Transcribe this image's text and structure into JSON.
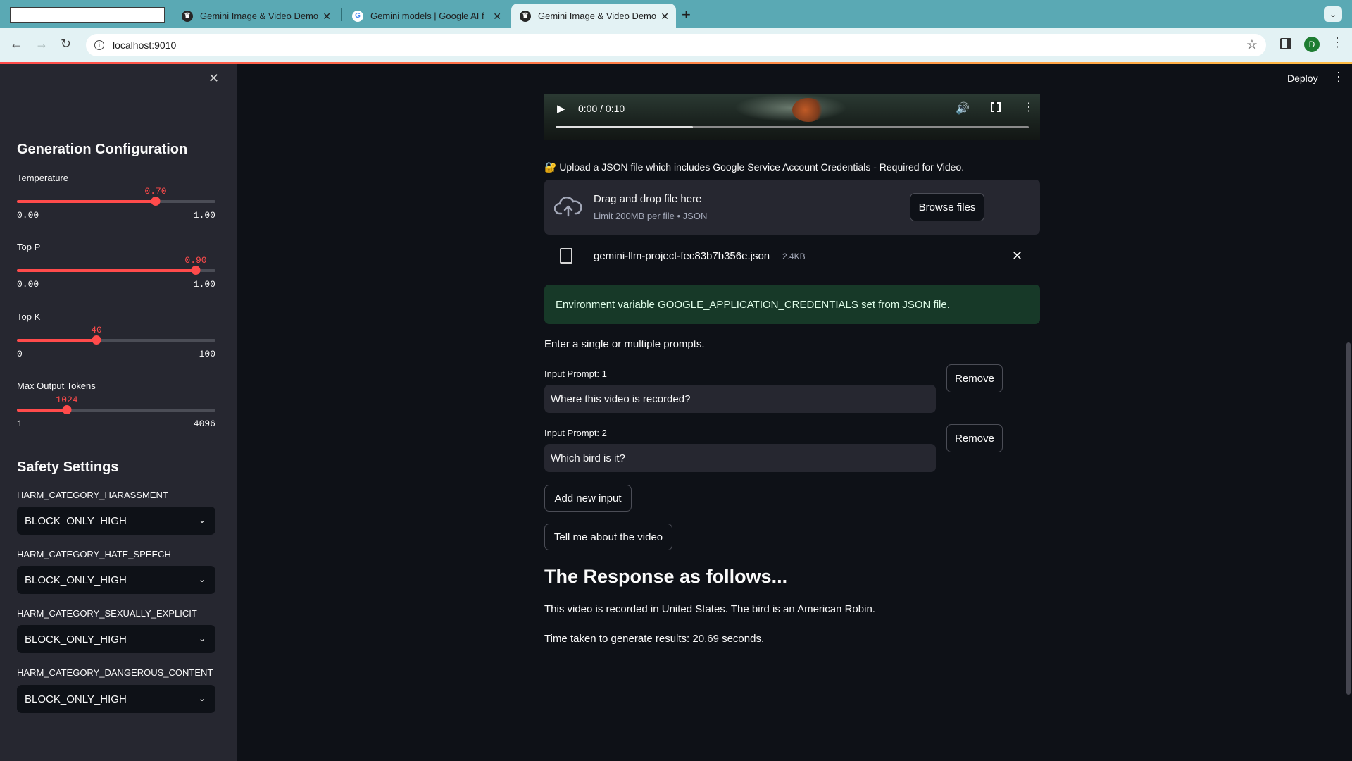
{
  "browser": {
    "tabs": [
      {
        "title": "Gemini Image & Video Demo",
        "favicon": "streamlit-icon",
        "active": false
      },
      {
        "title": "Gemini models | Google AI f",
        "favicon": "google-icon",
        "active": false
      },
      {
        "title": "Gemini Image & Video Demo",
        "favicon": "streamlit-icon",
        "active": true
      }
    ],
    "url": "localhost:9010",
    "profile_initial": "D"
  },
  "sidebar": {
    "gen_heading": "Generation Configuration",
    "sliders": [
      {
        "label": "Temperature",
        "value": "0.70",
        "fraction": 0.7,
        "min": "0.00",
        "max": "1.00"
      },
      {
        "label": "Top P",
        "value": "0.90",
        "fraction": 0.9,
        "min": "0.00",
        "max": "1.00"
      },
      {
        "label": "Top K",
        "value": "40",
        "fraction": 0.4,
        "min": "0",
        "max": "100"
      },
      {
        "label": "Max Output Tokens",
        "value": "1024",
        "fraction": 0.25,
        "min": "1",
        "max": "4096"
      }
    ],
    "safety_heading": "Safety Settings",
    "safety": [
      {
        "label": "HARM_CATEGORY_HARASSMENT",
        "value": "BLOCK_ONLY_HIGH"
      },
      {
        "label": "HARM_CATEGORY_HATE_SPEECH",
        "value": "BLOCK_ONLY_HIGH"
      },
      {
        "label": "HARM_CATEGORY_SEXUALLY_EXPLICIT",
        "value": "BLOCK_ONLY_HIGH"
      },
      {
        "label": "HARM_CATEGORY_DANGEROUS_CONTENT",
        "value": "BLOCK_ONLY_HIGH"
      }
    ]
  },
  "header": {
    "deploy": "Deploy"
  },
  "video": {
    "time": "0:00 / 0:10",
    "progress_fraction": 0.29
  },
  "upload": {
    "label": "🔐 Upload a JSON file which includes Google Service Account Credentials - Required for Video.",
    "drop_title": "Drag and drop file here",
    "drop_sub": "Limit 200MB per file • JSON",
    "browse": "Browse files",
    "file_name": "gemini-llm-project-fec83b7b356e.json",
    "file_size": "2.4KB"
  },
  "success_msg": "Environment variable GOOGLE_APPLICATION_CREDENTIALS set from JSON file.",
  "prompts_intro": "Enter a single or multiple prompts.",
  "prompts": [
    {
      "label": "Input Prompt: 1",
      "value": "Where this video is recorded?",
      "remove": "Remove"
    },
    {
      "label": "Input Prompt: 2",
      "value": "Which bird is it?",
      "remove": "Remove"
    }
  ],
  "buttons": {
    "add": "Add new input",
    "submit": "Tell me about the video"
  },
  "response": {
    "heading": "The Response as follows...",
    "text": "This video is recorded in United States. The bird is an American Robin.",
    "timing": "Time taken to generate results: 20.69 seconds."
  }
}
